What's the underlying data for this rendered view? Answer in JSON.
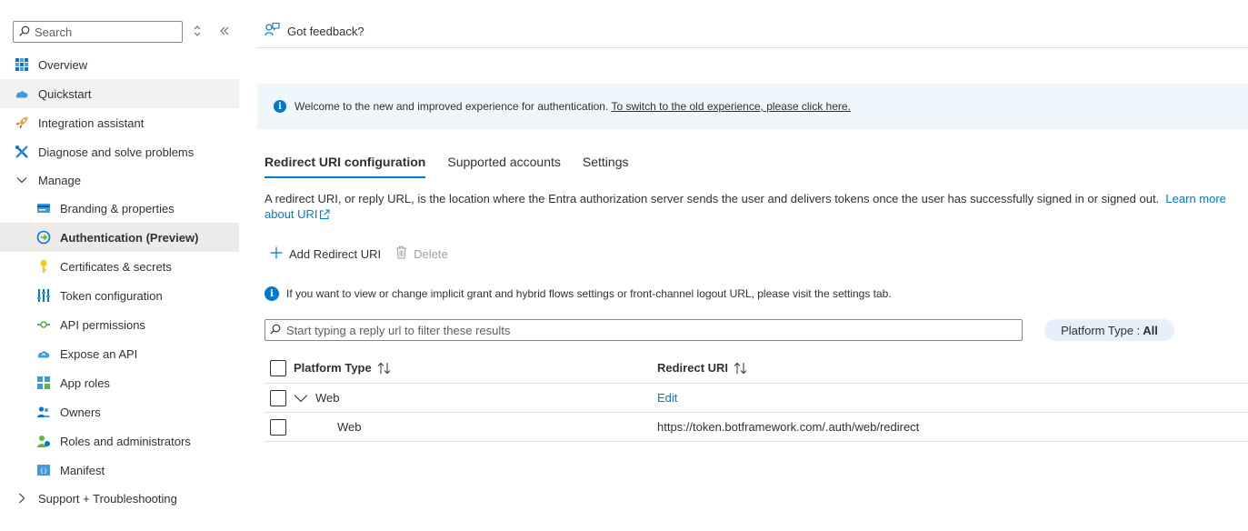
{
  "sidebar": {
    "search_placeholder": "Search",
    "items": [
      {
        "label": "Overview"
      },
      {
        "label": "Quickstart"
      },
      {
        "label": "Integration assistant"
      },
      {
        "label": "Diagnose and solve problems"
      },
      {
        "label": "Manage"
      },
      {
        "label": "Branding & properties"
      },
      {
        "label": "Authentication (Preview)"
      },
      {
        "label": "Certificates & secrets"
      },
      {
        "label": "Token configuration"
      },
      {
        "label": "API permissions"
      },
      {
        "label": "Expose an API"
      },
      {
        "label": "App roles"
      },
      {
        "label": "Owners"
      },
      {
        "label": "Roles and administrators"
      },
      {
        "label": "Manifest"
      },
      {
        "label": "Support + Troubleshooting"
      }
    ]
  },
  "header": {
    "feedback_label": "Got feedback?"
  },
  "banner": {
    "text": "Welcome to the new and improved experience for authentication.",
    "link": "To switch to the old experience, please click here."
  },
  "tabs": [
    {
      "label": "Redirect URI configuration",
      "active": true
    },
    {
      "label": "Supported accounts",
      "active": false
    },
    {
      "label": "Settings",
      "active": false
    }
  ],
  "description": {
    "text": "A redirect URI, or reply URL, is the location where the Entra authorization server sends the user and delivers tokens once the user has successfully signed in or signed out.",
    "link": "Learn more about URI"
  },
  "toolbar": {
    "add_label": "Add Redirect URI",
    "delete_label": "Delete"
  },
  "implicit_note": "If you want to view or change implicit grant and hybrid flows settings or front-channel logout URL, please visit the settings tab.",
  "filter": {
    "placeholder": "Start typing a reply url to filter these results"
  },
  "platform_filter": {
    "label": "Platform Type :",
    "value": "All"
  },
  "grid": {
    "columns": [
      "Platform Type",
      "Redirect URI"
    ],
    "group": {
      "platform": "Web",
      "action": "Edit"
    },
    "rows": [
      {
        "platform": "Web",
        "uri": "https://token.botframework.com/.auth/web/redirect"
      }
    ]
  },
  "colors": {
    "accent": "#0078d4",
    "banner_bg": "#eff6fc",
    "selected_bg": "#edebe9",
    "pill_bg": "#e6f0fa"
  }
}
